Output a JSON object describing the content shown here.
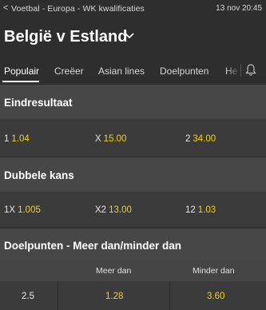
{
  "breadcrumb": {
    "back_icon": "chevron-left-icon",
    "text": "Voetbal - Europa - WK kwalificaties"
  },
  "event": {
    "datetime": "13 nov 20:45",
    "title": "België v Estland",
    "dropdown_icon": "chevron-down-icon"
  },
  "tabs": [
    {
      "label": "Populair",
      "active": true
    },
    {
      "label": "Creëer"
    },
    {
      "label": "Asian lines"
    },
    {
      "label": "Doelpunten"
    },
    {
      "label": "He"
    }
  ],
  "notification_icon": "bell-icon",
  "markets": {
    "result": {
      "title": "Eindresultaat",
      "selections": [
        {
          "label": "1",
          "odds": "1.04"
        },
        {
          "label": "X",
          "odds": "15.00"
        },
        {
          "label": "2",
          "odds": "34.00"
        }
      ]
    },
    "double_chance": {
      "title": "Dubbele kans",
      "selections": [
        {
          "label": "1X",
          "odds": "1.005"
        },
        {
          "label": "X2",
          "odds": "13.00"
        },
        {
          "label": "12",
          "odds": "1.03"
        }
      ]
    },
    "goals": {
      "title": "Doelpunten - Meer dan/minder dan",
      "columns": {
        "over": "Meer dan",
        "under": "Minder dan"
      },
      "rows": [
        {
          "line": "2.5",
          "over": "1.28",
          "under": "3.60"
        }
      ]
    }
  },
  "colors": {
    "odds": "#f2d21b",
    "background": "#3a3a3a",
    "header": "#2e2e2e"
  }
}
